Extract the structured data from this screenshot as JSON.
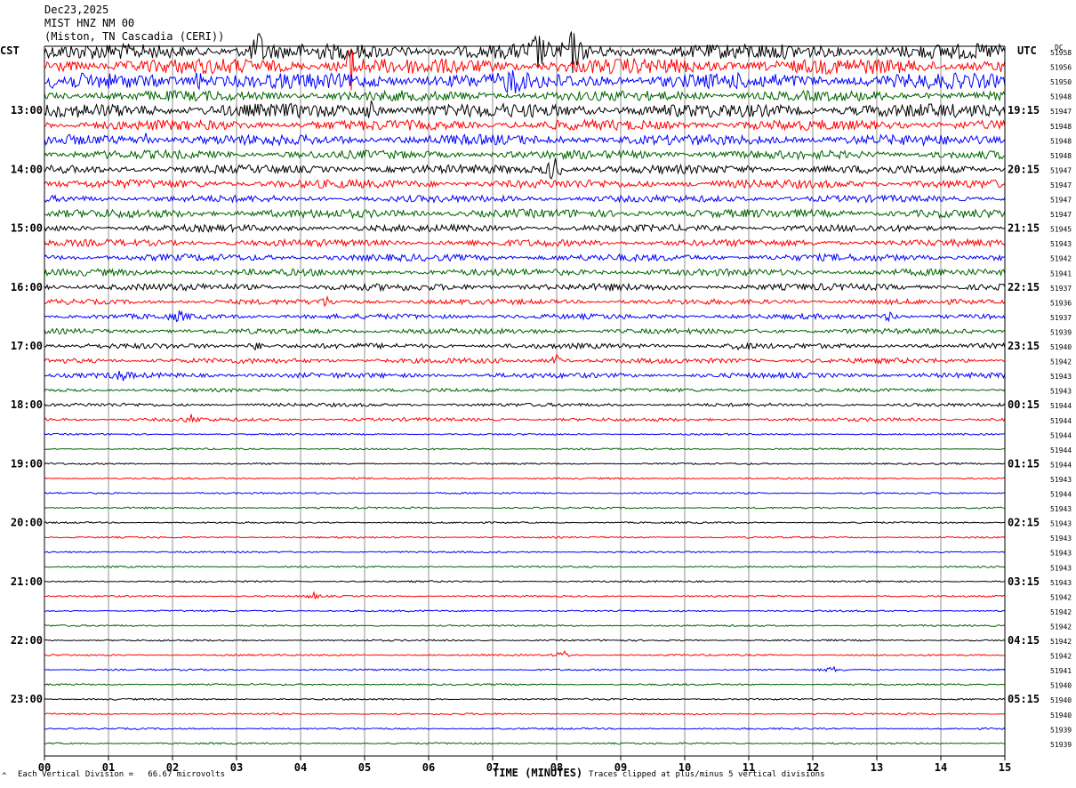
{
  "header": {
    "date": "Dec23,2025",
    "station": "MIST HNZ NM 00",
    "location": "(Miston, TN Cascadia (CERI))"
  },
  "left_axis_title": "CST",
  "right_axis_title": "UTC",
  "dc_header": "DC",
  "footer": {
    "scale_note": "Each Vertical Division =   66.67 microvolts",
    "clip_note": "Traces clipped at plus/minus 5 vertical divisions",
    "corner_mark": "^"
  },
  "chart_data": {
    "type": "line",
    "title": "MIST HNZ NM 00",
    "xlabel": "TIME (MINUTES)",
    "ylabel": "",
    "x_ticks": [
      "00",
      "01",
      "02",
      "03",
      "04",
      "05",
      "06",
      "07",
      "08",
      "09",
      "10",
      "11",
      "12",
      "13",
      "14",
      "15"
    ],
    "xlim": [
      0,
      15
    ],
    "trace_colors": [
      "#000000",
      "#ff0000",
      "#0000ff",
      "#006400"
    ],
    "cst_hour_labels": [
      "13:00",
      "14:00",
      "15:00",
      "16:00",
      "17:00",
      "18:00",
      "19:00",
      "20:00",
      "21:00",
      "22:00",
      "23:00"
    ],
    "utc_hour_labels": [
      "19:15",
      "20:15",
      "21:15",
      "22:15",
      "23:15",
      "00:15",
      "01:15",
      "02:15",
      "03:15",
      "04:15",
      "05:15"
    ],
    "dc_values": [
      "51958",
      "51956",
      "51950",
      "51948",
      "51947",
      "51948",
      "51948",
      "51948",
      "51947",
      "51947",
      "51947",
      "51947",
      "51945",
      "51943",
      "51942",
      "51941",
      "51937",
      "51936",
      "51937",
      "51939",
      "51940",
      "51942",
      "51943",
      "51943",
      "51944",
      "51944",
      "51944",
      "51944",
      "51944",
      "51943",
      "51944",
      "51943",
      "51943",
      "51943",
      "51943",
      "51943",
      "51943",
      "51942",
      "51942",
      "51942",
      "51942",
      "51942",
      "51941",
      "51940",
      "51940",
      "51940",
      "51939",
      "51939"
    ],
    "trace_activity": [
      9,
      9,
      9,
      6,
      8,
      6,
      6,
      5,
      5,
      5,
      4,
      5,
      4,
      4,
      4,
      4,
      4,
      3,
      3,
      3,
      3,
      3,
      3,
      2,
      2,
      2,
      1,
      1,
      1,
      1,
      1,
      1,
      1,
      1,
      1,
      1,
      1,
      1,
      1,
      1,
      1,
      1,
      1,
      1,
      1,
      1,
      1,
      1
    ],
    "events": [
      {
        "row": 0,
        "minute": 3.35,
        "amp": 22
      },
      {
        "row": 0,
        "minute": 7.7,
        "amp": 20
      },
      {
        "row": 0,
        "minute": 8.25,
        "amp": 22
      },
      {
        "row": 1,
        "minute": 4.8,
        "amp": 26
      },
      {
        "row": 2,
        "minute": 2.4,
        "amp": 10
      },
      {
        "row": 2,
        "minute": 7.3,
        "amp": 14
      },
      {
        "row": 4,
        "minute": 5.1,
        "amp": 8
      },
      {
        "row": 6,
        "minute": 1.6,
        "amp": 8
      },
      {
        "row": 8,
        "minute": 7.95,
        "amp": 18
      },
      {
        "row": 17,
        "minute": 4.4,
        "amp": 5
      },
      {
        "row": 18,
        "minute": 2.1,
        "amp": 5
      },
      {
        "row": 18,
        "minute": 13.2,
        "amp": 5
      },
      {
        "row": 20,
        "minute": 3.3,
        "amp": 6
      },
      {
        "row": 20,
        "minute": 10.9,
        "amp": 6
      },
      {
        "row": 21,
        "minute": 8.0,
        "amp": 6
      },
      {
        "row": 22,
        "minute": 1.2,
        "amp": 6
      },
      {
        "row": 25,
        "minute": 2.3,
        "amp": 5
      },
      {
        "row": 37,
        "minute": 4.2,
        "amp": 4
      },
      {
        "row": 41,
        "minute": 8.1,
        "amp": 6
      },
      {
        "row": 42,
        "minute": 12.3,
        "amp": 4
      }
    ]
  }
}
